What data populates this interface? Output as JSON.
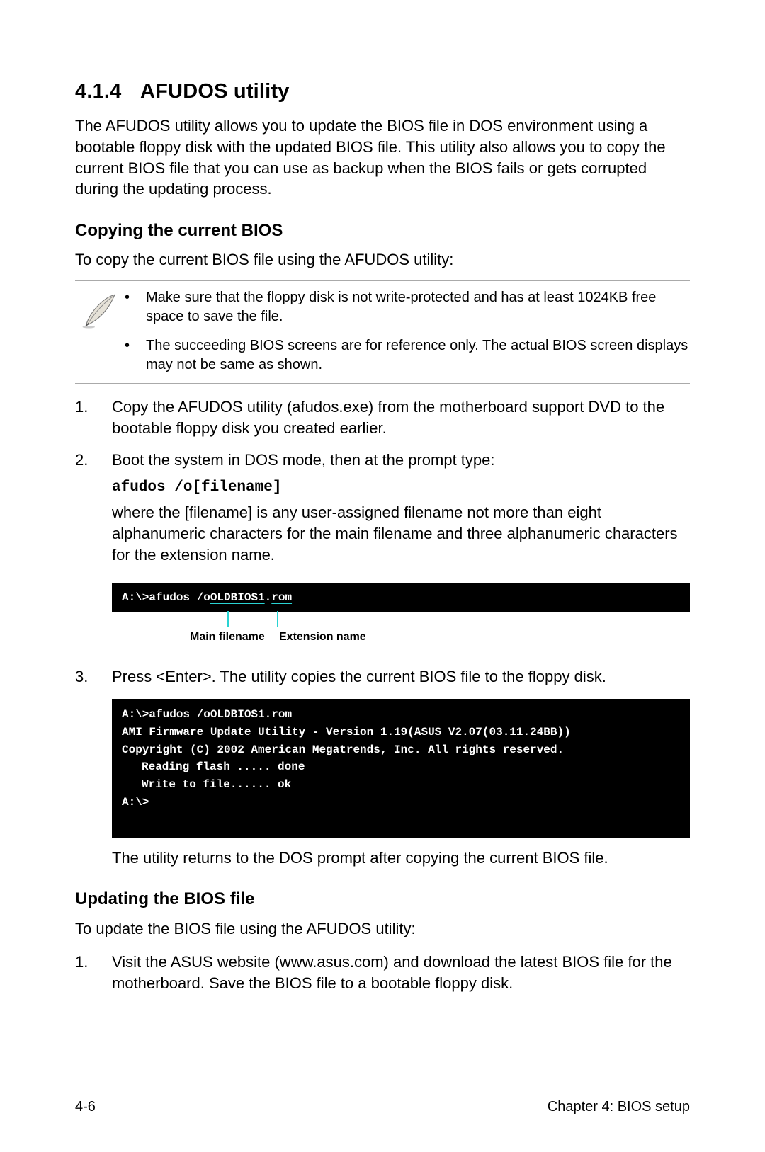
{
  "section_number": "4.1.4",
  "section_title": "AFUDOS utility",
  "intro": "The AFUDOS utility allows you to update the BIOS file in DOS environment using a bootable floppy disk with the updated BIOS file. This utility also allows you to copy the current BIOS file that you can use as backup when the BIOS fails or gets corrupted during the updating process.",
  "sub1": "Copying the current BIOS",
  "sub1_lead": "To copy the current BIOS file using the AFUDOS utility:",
  "note_bullets": {
    "b1": "Make sure that the floppy disk is not write-protected and has at least 1024KB free space to save the file.",
    "b2": "The succeeding BIOS screens are for reference only. The actual BIOS screen displays may not be same as shown."
  },
  "steps1": {
    "n1": "1.",
    "t1": "Copy the AFUDOS utility (afudos.exe) from the motherboard support DVD to the bootable floppy disk you created earlier.",
    "n2": "2.",
    "t2a": "Boot the system in DOS mode, then at the prompt type:",
    "t2code": "afudos /o[filename]",
    "t2b": "where the [filename] is any user-assigned filename not more than eight alphanumeric characters  for the main filename and three alphanumeric characters for the extension name.",
    "n3": "3.",
    "t3": "Press <Enter>. The utility copies the current BIOS file to the floppy disk.",
    "t3after": "The utility returns to the DOS prompt after copying the current BIOS file."
  },
  "term1": {
    "prefix": "A:\\>afudos /o",
    "main": "OLDBIOS1",
    "dot": ".",
    "ext": "rom"
  },
  "callout": {
    "main": "Main filename",
    "ext": "Extension name"
  },
  "term2": {
    "l1": "A:\\>afudos /oOLDBIOS1.rom",
    "l2": "AMI Firmware Update Utility - Version 1.19(ASUS V2.07(03.11.24BB))",
    "l3": "Copyright (C) 2002 American Megatrends, Inc. All rights reserved.",
    "l4": "Reading flash ..... done",
    "l5": "Write to file...... ok",
    "l6": "A:\\>"
  },
  "sub2": "Updating the BIOS file",
  "sub2_lead": "To update the BIOS file using the AFUDOS utility:",
  "steps2": {
    "n1": "1.",
    "t1": "Visit the ASUS website (www.asus.com) and download the latest BIOS file for the motherboard. Save the BIOS file to a bootable floppy disk."
  },
  "footer": {
    "left": "4-6",
    "right": "Chapter 4: BIOS setup"
  }
}
